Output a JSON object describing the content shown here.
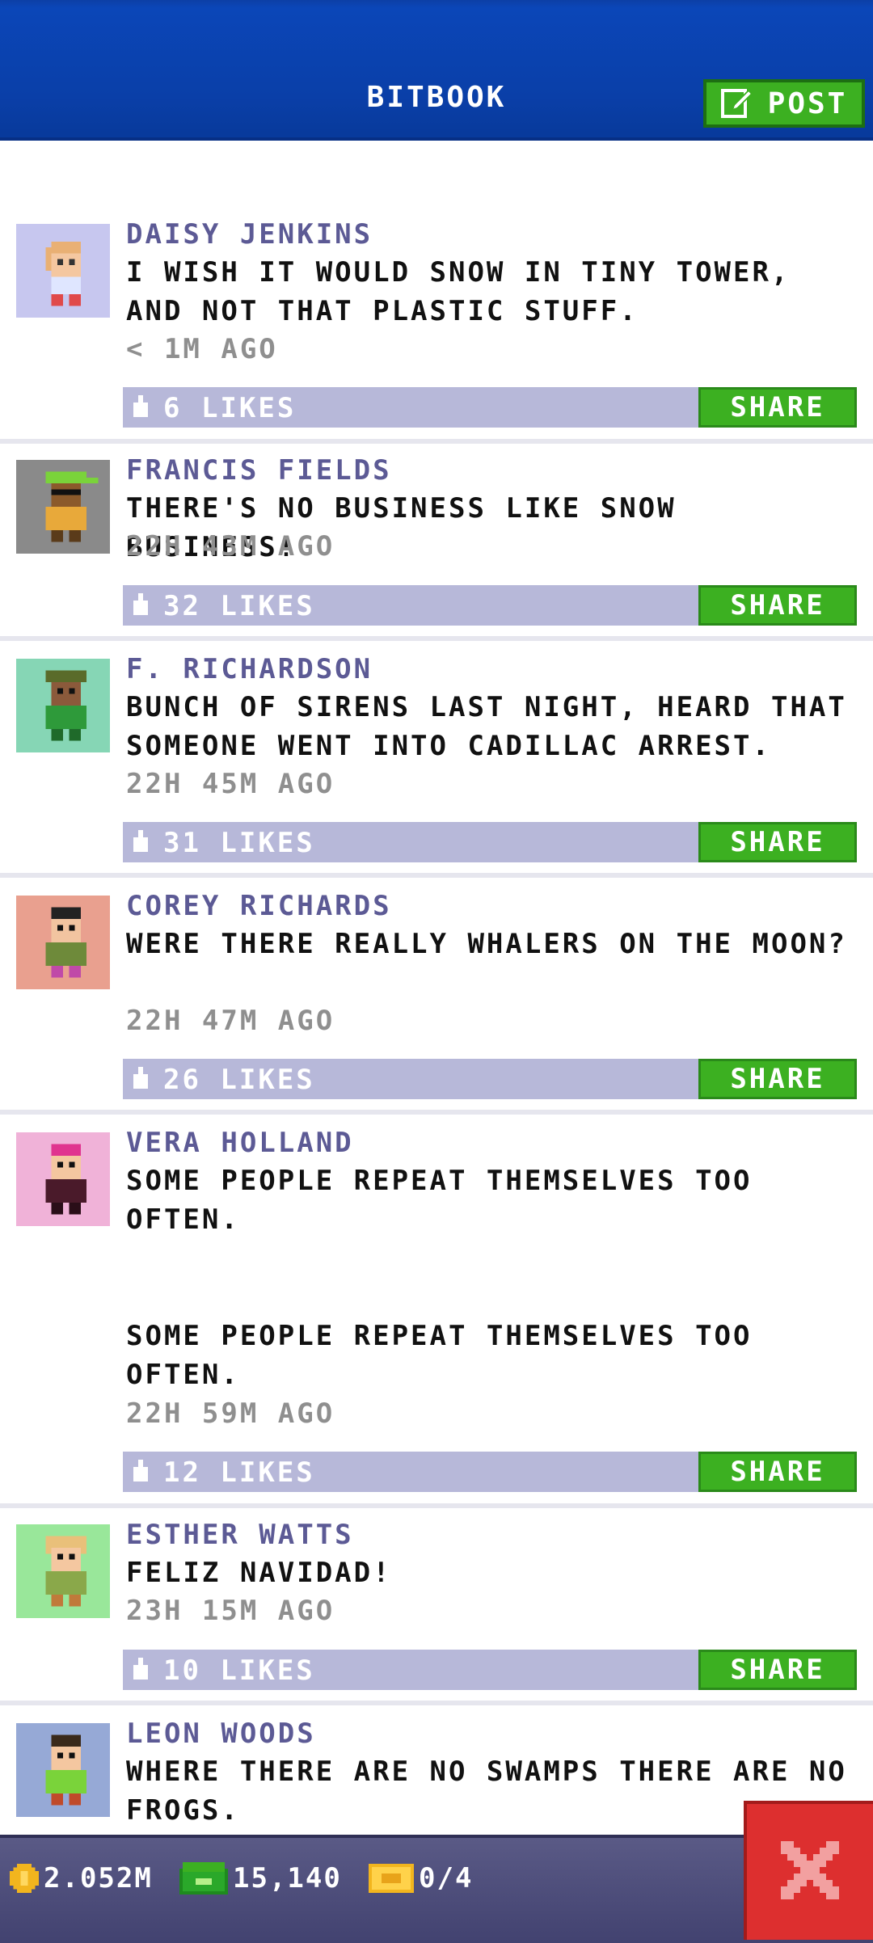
{
  "header": {
    "title": "BITBOOK",
    "post_label": "POST"
  },
  "posts": [
    {
      "name": "DAISY JENKINS",
      "message": "I WISH IT WOULD SNOW IN TINY TOWER, AND NOT THAT PLASTIC STUFF.",
      "time": "< 1M AGO",
      "likes": "6 LIKES",
      "share": "SHARE",
      "avatar_bg": "#c7c7ef"
    },
    {
      "name": "FRANCIS FIELDS",
      "message": "THERE'S NO BUSINESS LIKE SNOW BUSINESS!",
      "time": "22H 43M AGO",
      "likes": "32 LIKES",
      "share": "SHARE",
      "avatar_bg": "#8a8a8a"
    },
    {
      "name": "F. RICHARDSON",
      "message": "BUNCH OF SIRENS LAST NIGHT, HEARD THAT SOMEONE WENT INTO CADILLAC ARREST.",
      "time": "22H 45M AGO",
      "likes": "31 LIKES",
      "share": "SHARE",
      "avatar_bg": "#86d6b5"
    },
    {
      "name": "COREY RICHARDS",
      "message": "WERE THERE REALLY WHALERS ON THE MOON?",
      "time": "22H 47M AGO",
      "likes": "26 LIKES",
      "share": "SHARE",
      "avatar_bg": "#e9a08f"
    },
    {
      "name": "VERA HOLLAND",
      "message": "SOME PEOPLE REPEAT THEMSELVES TOO OFTEN.",
      "message2": "SOME PEOPLE REPEAT THEMSELVES TOO OFTEN.",
      "time": "22H 59M AGO",
      "likes": "12 LIKES",
      "share": "SHARE",
      "avatar_bg": "#f0b2d8"
    },
    {
      "name": "ESTHER WATTS",
      "message": "FELIZ NAVIDAD!",
      "time": "23H 15M AGO",
      "likes": "10 LIKES",
      "share": "SHARE",
      "avatar_bg": "#99e79a"
    },
    {
      "name": "LEON WOODS",
      "message": "WHERE THERE ARE NO SWAMPS THERE ARE NO FROGS.",
      "avatar_bg": "#96a9d6"
    }
  ],
  "bottom_bar": {
    "coins": "2.052M",
    "bux": "15,140",
    "tickets": "0/4"
  },
  "colors": {
    "accent_green": "#3cb021",
    "header_blue": "#0b46b8",
    "likes_bar": "#b7b8d9",
    "close_red": "#dd2f2f"
  }
}
